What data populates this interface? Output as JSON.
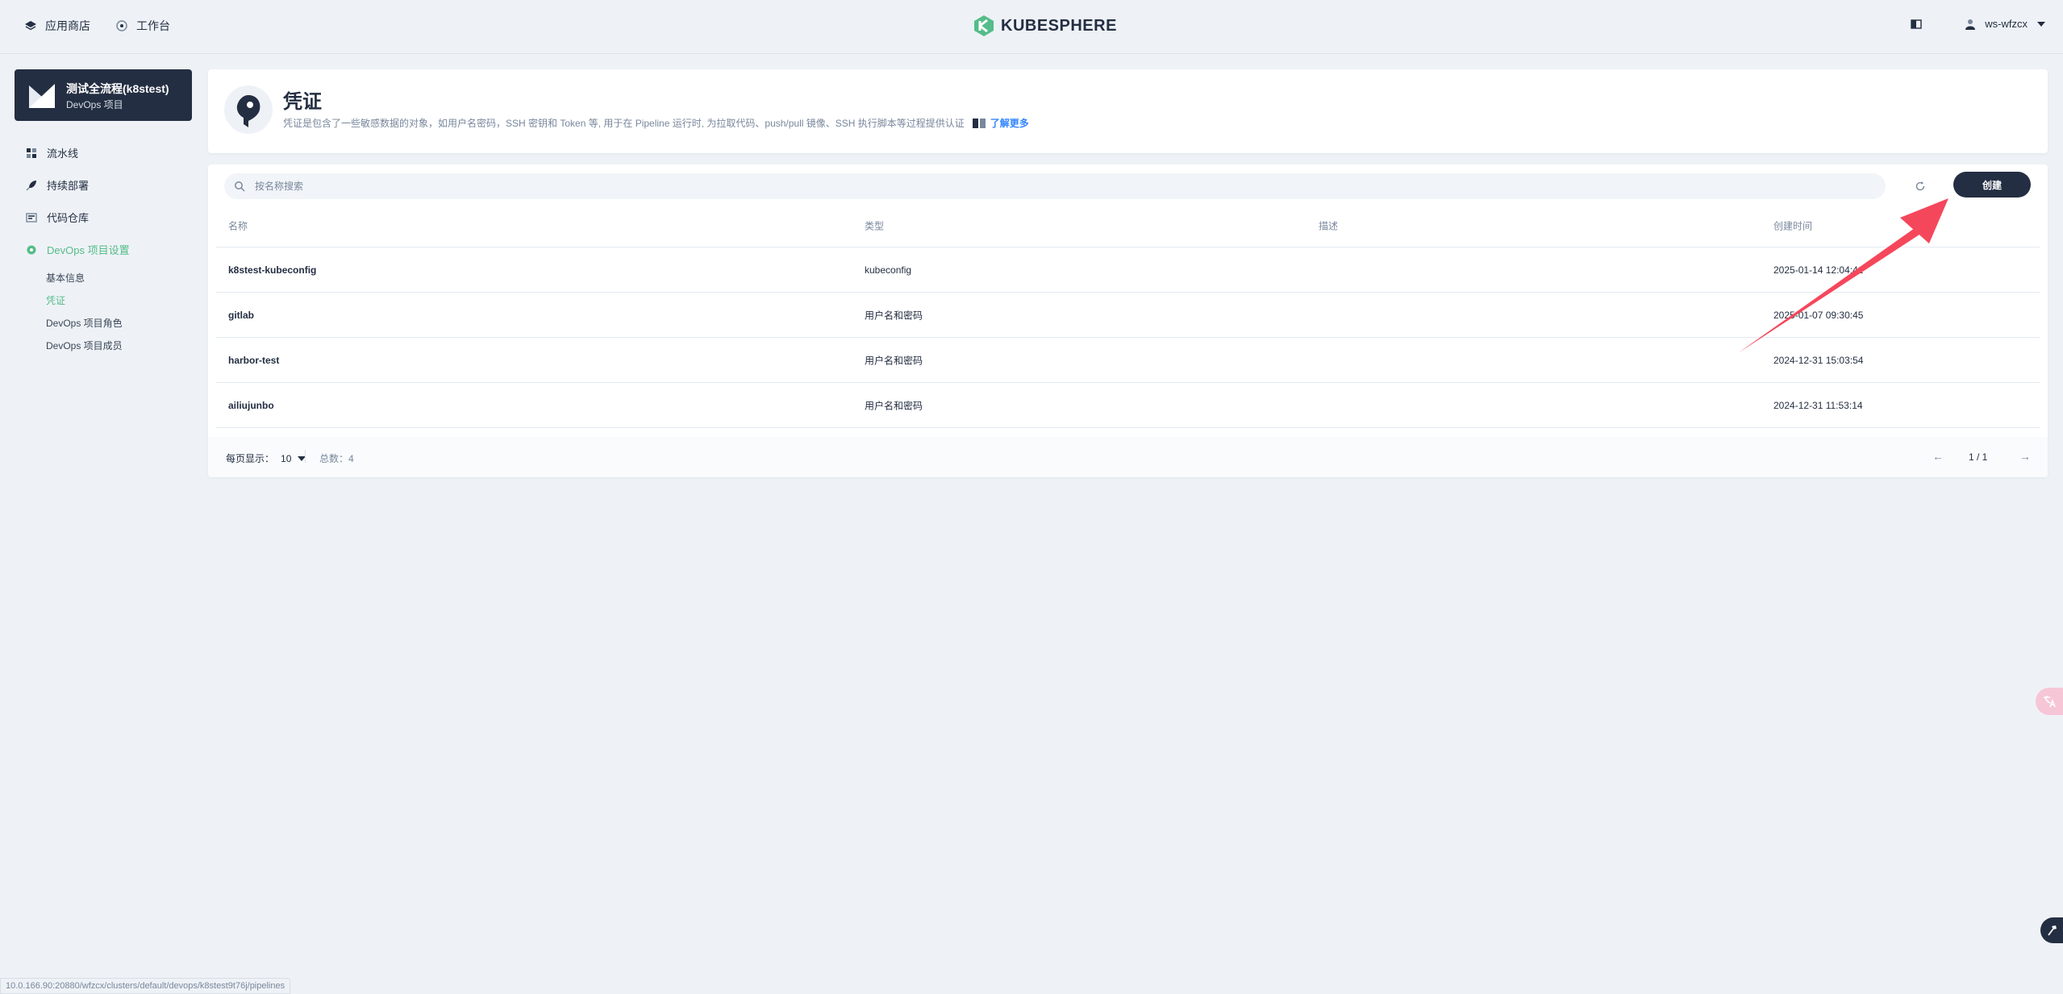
{
  "topbar": {
    "app_store": "应用商店",
    "workbench": "工作台",
    "logo_text": "KUBESPHERE",
    "user": "ws-wfzcx"
  },
  "sidebar": {
    "project_name": "测试全流程(k8stest)",
    "project_type": "DevOps 项目",
    "items": [
      {
        "label": "流水线",
        "icon": "grid-icon"
      },
      {
        "label": "持续部署",
        "icon": "rocket-icon"
      },
      {
        "label": "代码仓库",
        "icon": "repo-icon"
      },
      {
        "label": "DevOps 项目设置",
        "icon": "gear-icon"
      }
    ],
    "subitems": [
      "基本信息",
      "凭证",
      "DevOps 项目角色",
      "DevOps 项目成员"
    ]
  },
  "header": {
    "title": "凭证",
    "description": "凭证是包含了一些敏感数据的对象，如用户名密码，SSH 密钥和 Token 等, 用于在 Pipeline 运行时, 为拉取代码、push/pull 镜像、SSH 执行脚本等过程提供认证",
    "learn_more": "了解更多"
  },
  "toolbar": {
    "search_placeholder": "按名称搜索",
    "create_label": "创建"
  },
  "table": {
    "columns": [
      "名称",
      "类型",
      "描述",
      "创建时间"
    ],
    "rows": [
      {
        "name": "k8stest-kubeconfig",
        "type": "kubeconfig",
        "desc": "",
        "created": "2025-01-14 12:04:41"
      },
      {
        "name": "gitlab",
        "type": "用户名和密码",
        "desc": "",
        "created": "2025-01-07 09:30:45"
      },
      {
        "name": "harbor-test",
        "type": "用户名和密码",
        "desc": "",
        "created": "2024-12-31 15:03:54"
      },
      {
        "name": "ailiujunbo",
        "type": "用户名和密码",
        "desc": "",
        "created": "2024-12-31 11:53:14"
      }
    ]
  },
  "pagination": {
    "per_page_label": "每页显示：",
    "per_page_value": "10",
    "total_label": "总数：",
    "total_value": "4",
    "page_info": "1 / 1",
    "prev": "←",
    "next": "→"
  },
  "status_url": "10.0.166.90:20880/wfzcx/clusters/default/devops/k8stest9t76j/pipelines",
  "colors": {
    "accent": "#55bc8a",
    "dark": "#242e42",
    "link": "#3385ff",
    "annotation_arrow": "#f5475b"
  }
}
